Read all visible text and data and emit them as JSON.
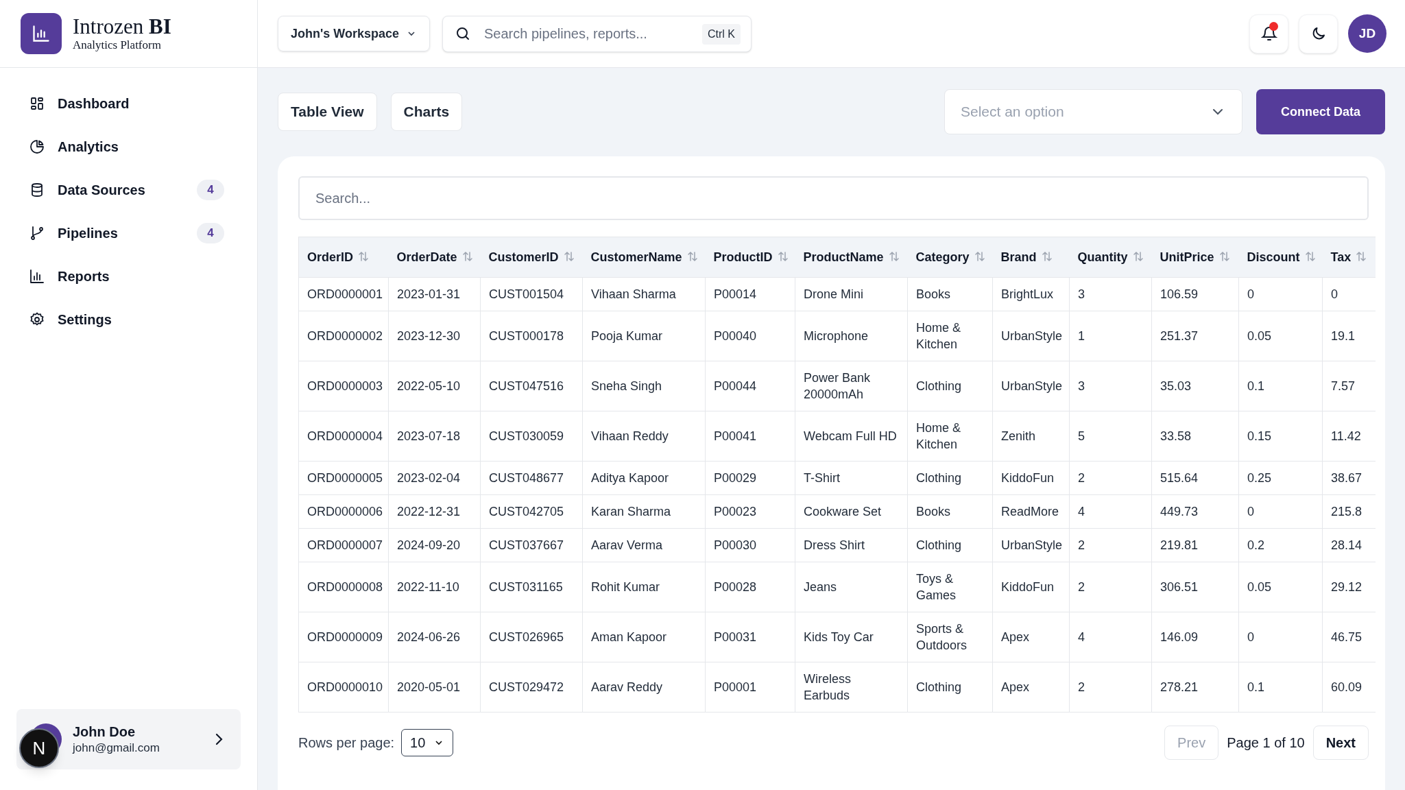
{
  "brand": {
    "name": "Introzen",
    "name_bold": "BI",
    "tagline": "Analytics Platform"
  },
  "sidebar": {
    "items": [
      {
        "label": "Dashboard"
      },
      {
        "label": "Analytics"
      },
      {
        "label": "Data Sources",
        "badge": "4"
      },
      {
        "label": "Pipelines",
        "badge": "4"
      },
      {
        "label": "Reports"
      },
      {
        "label": "Settings"
      }
    ],
    "user": {
      "name": "John Doe",
      "email": "john@gmail.com"
    },
    "dev_badge": "N"
  },
  "topbar": {
    "workspace": "John's Workspace",
    "search": {
      "placeholder": "Search pipelines, reports...",
      "shortcut": "Ctrl K"
    },
    "notification": true,
    "avatar": "JD"
  },
  "toolbar": {
    "views": [
      "Table View",
      "Charts"
    ],
    "select": {
      "placeholder": "Select an option"
    },
    "action": "Connect Data"
  },
  "table": {
    "search": {
      "placeholder": "Search..."
    },
    "columns": [
      "OrderID",
      "OrderDate",
      "CustomerID",
      "CustomerName",
      "ProductID",
      "ProductName",
      "Category",
      "Brand",
      "Quantity",
      "UnitPrice",
      "Discount",
      "Tax"
    ],
    "rows": [
      [
        "ORD0000001",
        "2023-01-31",
        "CUST001504",
        "Vihaan Sharma",
        "P00014",
        "Drone Mini",
        "Books",
        "BrightLux",
        "3",
        "106.59",
        "0",
        "0"
      ],
      [
        "ORD0000002",
        "2023-12-30",
        "CUST000178",
        "Pooja Kumar",
        "P00040",
        "Microphone",
        "Home & Kitchen",
        "UrbanStyle",
        "1",
        "251.37",
        "0.05",
        "19.1"
      ],
      [
        "ORD0000003",
        "2022-05-10",
        "CUST047516",
        "Sneha Singh",
        "P00044",
        "Power Bank 20000mAh",
        "Clothing",
        "UrbanStyle",
        "3",
        "35.03",
        "0.1",
        "7.57"
      ],
      [
        "ORD0000004",
        "2023-07-18",
        "CUST030059",
        "Vihaan Reddy",
        "P00041",
        "Webcam Full HD",
        "Home & Kitchen",
        "Zenith",
        "5",
        "33.58",
        "0.15",
        "11.42"
      ],
      [
        "ORD0000005",
        "2023-02-04",
        "CUST048677",
        "Aditya Kapoor",
        "P00029",
        "T-Shirt",
        "Clothing",
        "KiddoFun",
        "2",
        "515.64",
        "0.25",
        "38.67"
      ],
      [
        "ORD0000006",
        "2022-12-31",
        "CUST042705",
        "Karan Sharma",
        "P00023",
        "Cookware Set",
        "Books",
        "ReadMore",
        "4",
        "449.73",
        "0",
        "215.8"
      ],
      [
        "ORD0000007",
        "2024-09-20",
        "CUST037667",
        "Aarav Verma",
        "P00030",
        "Dress Shirt",
        "Clothing",
        "UrbanStyle",
        "2",
        "219.81",
        "0.2",
        "28.14"
      ],
      [
        "ORD0000008",
        "2022-11-10",
        "CUST031165",
        "Rohit Kumar",
        "P00028",
        "Jeans",
        "Toys & Games",
        "KiddoFun",
        "2",
        "306.51",
        "0.05",
        "29.12"
      ],
      [
        "ORD0000009",
        "2024-06-26",
        "CUST026965",
        "Aman Kapoor",
        "P00031",
        "Kids Toy Car",
        "Sports & Outdoors",
        "Apex",
        "4",
        "146.09",
        "0",
        "46.75"
      ],
      [
        "ORD0000010",
        "2020-05-01",
        "CUST029472",
        "Aarav Reddy",
        "P00001",
        "Wireless Earbuds",
        "Clothing",
        "Apex",
        "2",
        "278.21",
        "0.1",
        "60.09"
      ]
    ]
  },
  "pagination": {
    "rows_per_page_label": "Rows per page:",
    "rows_per_page": "10",
    "prev": {
      "label": "Prev",
      "disabled": true
    },
    "page": "Page 1 of 10",
    "next": {
      "label": "Next",
      "disabled": false
    }
  }
}
